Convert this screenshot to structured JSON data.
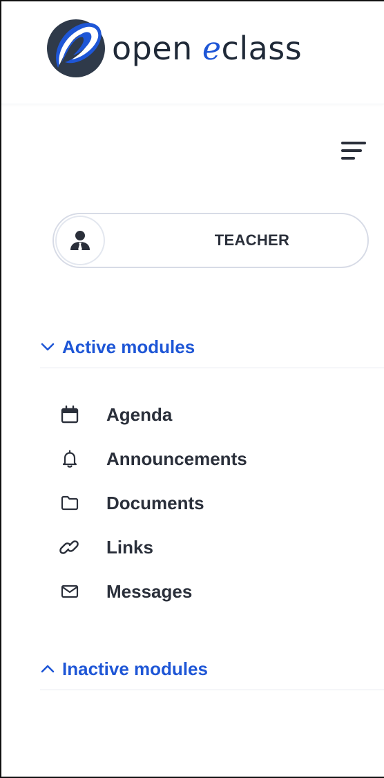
{
  "brand": {
    "name_prefix": "open",
    "name_accent": "e",
    "name_suffix": "class",
    "accent_color": "#1e56d6",
    "mark_color": "#2f3a4a"
  },
  "menu_toggle": {
    "icon": "hamburger-icon"
  },
  "role": {
    "label": "TEACHER",
    "icon": "user-tie-icon"
  },
  "active_section": {
    "label": "Active modules",
    "icon": "chevron-down-icon",
    "expanded": true
  },
  "modules": [
    {
      "label": "Agenda",
      "icon": "calendar-icon"
    },
    {
      "label": "Announcements",
      "icon": "bell-icon"
    },
    {
      "label": "Documents",
      "icon": "folder-icon"
    },
    {
      "label": "Links",
      "icon": "link-icon"
    },
    {
      "label": "Messages",
      "icon": "envelope-icon"
    }
  ],
  "inactive_section": {
    "label": "Inactive modules",
    "icon": "chevron-up-icon",
    "expanded": false
  },
  "colors": {
    "text": "#2a2f3a",
    "link": "#1e56d6",
    "border": "#d7dbe6"
  }
}
